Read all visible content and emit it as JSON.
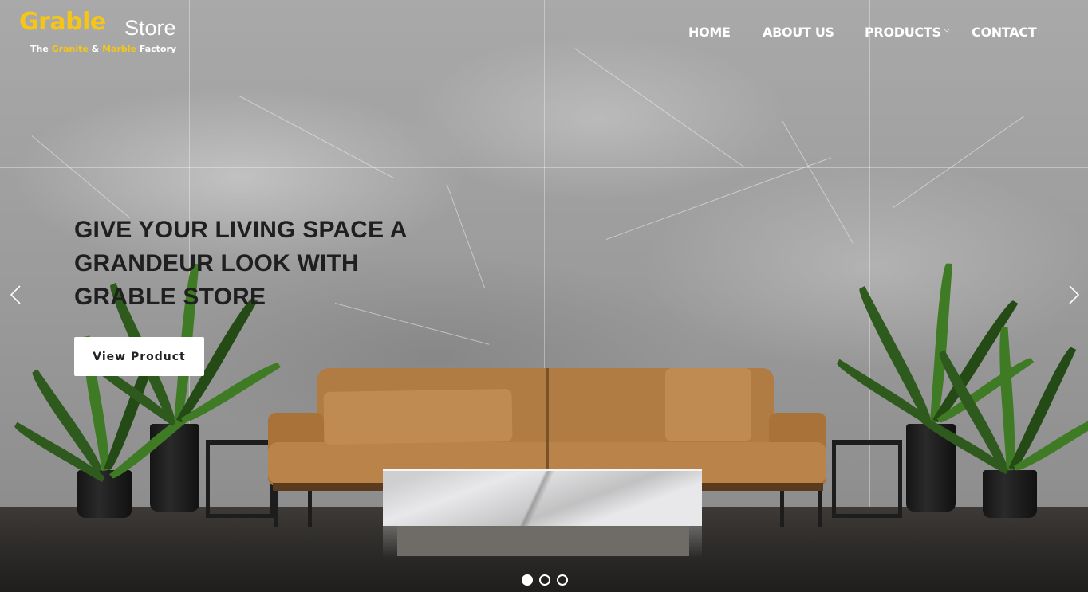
{
  "brand": {
    "logo_main": "Grable",
    "logo_store": "Store",
    "tagline_prefix": "The ",
    "tagline_granite": "Granite",
    "tagline_amp": " & ",
    "tagline_marble": "Marble",
    "tagline_suffix": " Factory",
    "accent_color": "#f5c518"
  },
  "nav": {
    "home": "HOME",
    "about": "ABOUT US",
    "products": "PRODUCTS",
    "contact": "CONTACT",
    "products_caret_icon": "chevron-down-icon"
  },
  "slide": {
    "headline": "GIVE YOUR LIVING SPACE A GRANDEUR LOOK WITH GRABLE STORE",
    "cta_label": "View Product",
    "prev_icon": "chevron-left-icon",
    "next_icon": "chevron-right-icon"
  },
  "carousel": {
    "total_slides": 3,
    "active_index": 0
  }
}
